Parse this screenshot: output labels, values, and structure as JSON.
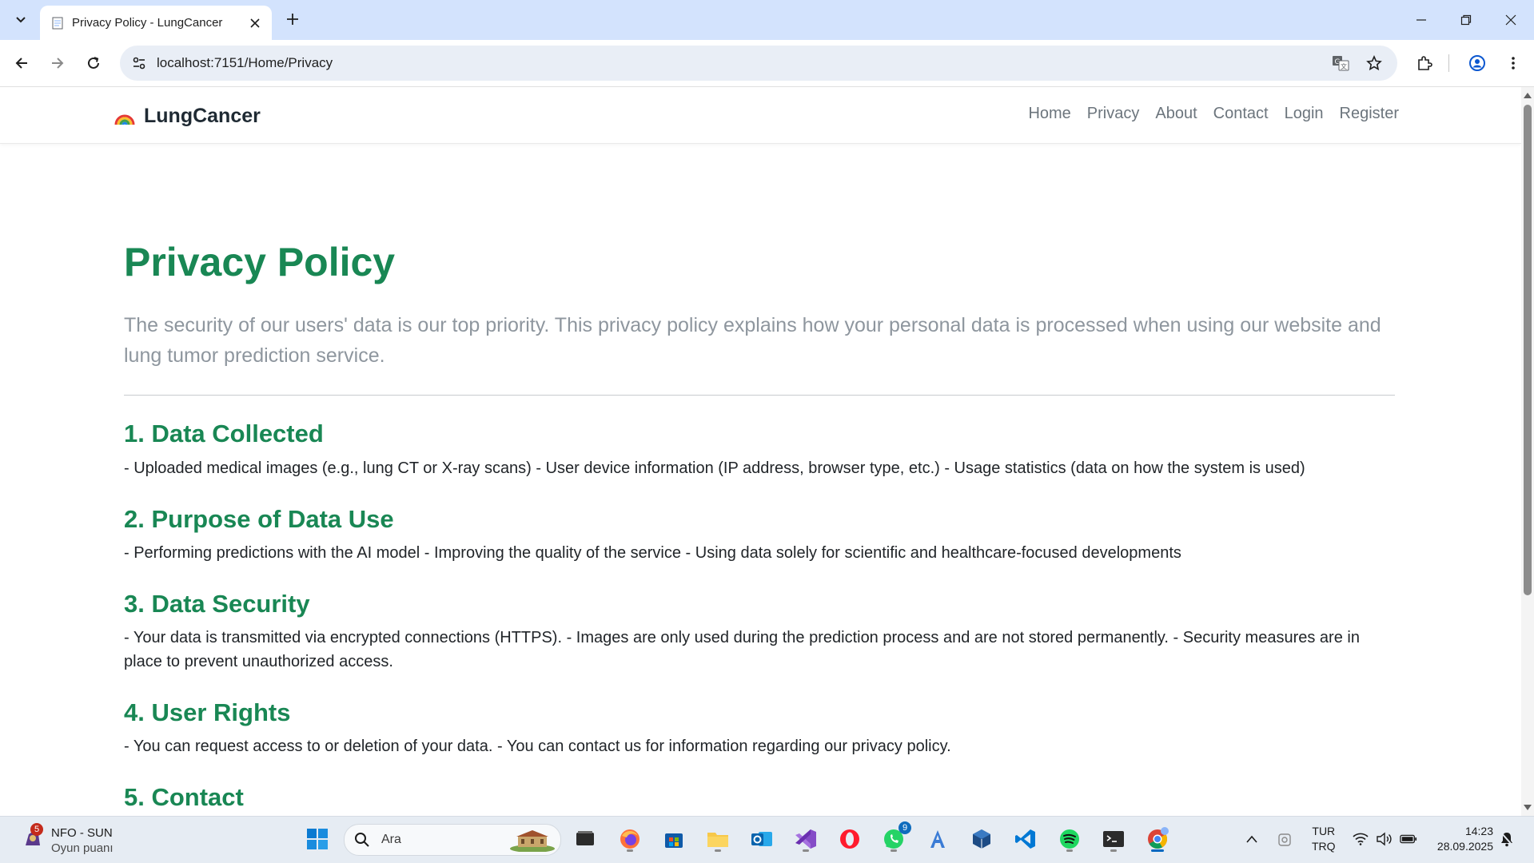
{
  "browser": {
    "tab_title": "Privacy Policy - LungCancer",
    "url": "localhost:7151/Home/Privacy"
  },
  "site": {
    "brand": "LungCancer",
    "nav": [
      "Home",
      "Privacy",
      "About",
      "Contact",
      "Login",
      "Register"
    ]
  },
  "page": {
    "title": "Privacy Policy",
    "lead": "The security of our users' data is our top priority. This privacy policy explains how your personal data is processed when using our website and lung tumor prediction service.",
    "sections": [
      {
        "heading": "1. Data Collected",
        "body": "- Uploaded medical images (e.g., lung CT or X-ray scans) - User device information (IP address, browser type, etc.) - Usage statistics (data on how the system is used)"
      },
      {
        "heading": "2. Purpose of Data Use",
        "body": "- Performing predictions with the AI model - Improving the quality of the service - Using data solely for scientific and healthcare-focused developments"
      },
      {
        "heading": "3. Data Security",
        "body": "- Your data is transmitted via encrypted connections (HTTPS). - Images are only used during the prediction process and are not stored permanently. - Security measures are in place to prevent unauthorized access."
      },
      {
        "heading": "4. User Rights",
        "body": "- You can request access to or deletion of your data. - You can contact us for information regarding our privacy policy."
      },
      {
        "heading": "5. Contact",
        "body": ""
      }
    ]
  },
  "taskbar": {
    "widget_badge": "5",
    "widget_title": "NFO - SUN",
    "widget_subtitle": "Oyun puanı",
    "search_placeholder": "Ara",
    "whatsapp_badge": "9",
    "language": "TUR",
    "keyboard": "TRQ",
    "time": "14:23",
    "date": "28.09.2025"
  },
  "colors": {
    "accent_green": "#198754",
    "tabbar_bg": "#d3e3fd",
    "omnibox_bg": "#e9eef6",
    "muted_text": "#8e969e"
  },
  "icons": [
    "tab-search-icon",
    "page-favicon-icon",
    "close-icon",
    "plus-icon",
    "minimize-icon",
    "restore-icon",
    "back-arrow-icon",
    "forward-arrow-icon",
    "reload-icon",
    "site-info-icon",
    "translate-icon",
    "star-icon",
    "extensions-icon",
    "profile-icon",
    "kebab-menu-icon",
    "rainbow-logo-icon"
  ]
}
